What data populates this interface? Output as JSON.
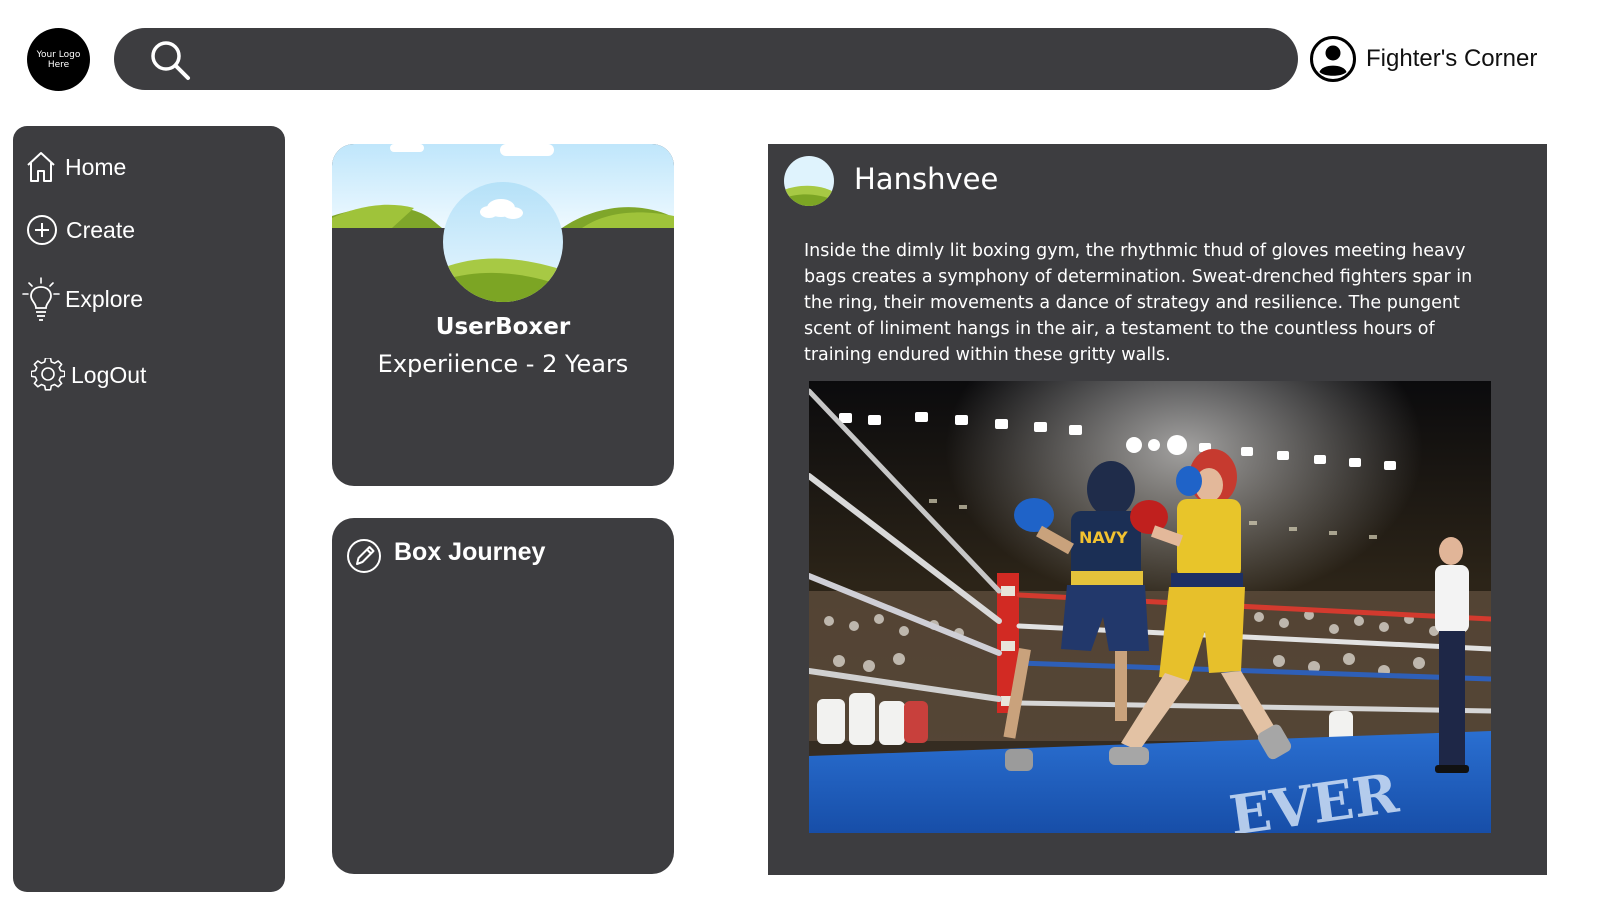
{
  "header": {
    "logo_text": "Your Logo\nHere",
    "search": {
      "placeholder": "",
      "value": ""
    },
    "account_name": "Fighter's Corner"
  },
  "sidebar": {
    "items": [
      {
        "label": "Home",
        "icon": "home-icon"
      },
      {
        "label": "Create",
        "icon": "plus-circle-icon"
      },
      {
        "label": "Explore",
        "icon": "lightbulb-icon"
      },
      {
        "label": "LogOut",
        "icon": "gear-icon"
      }
    ]
  },
  "profile": {
    "username": "UserBoxer",
    "experience": "Experiience - 2 Years"
  },
  "journey": {
    "title": "Box Journey",
    "icon": "pencil-circle-icon"
  },
  "post": {
    "author": "Hanshvee",
    "text": "Inside the dimly lit boxing gym, the rhythmic thud of gloves meeting heavy bags creates a symphony of determination. Sweat-drenched fighters spar in the ring, their movements a dance of strategy and resilience. The pungent scent of liniment hangs in the air, a testament to the countless hours of training endured within these gritty walls.",
    "image_jersey_text": "NAVY",
    "image_mat_text": "EVER"
  },
  "colors": {
    "panel": "#3d3d40",
    "page_bg": "#ffffff",
    "text_light": "#ffffff",
    "ring_mat": "#1e5fc4",
    "glove_red": "#c0201e",
    "glove_blue": "#1f63c8",
    "shirt_yellow": "#e8c52a"
  }
}
